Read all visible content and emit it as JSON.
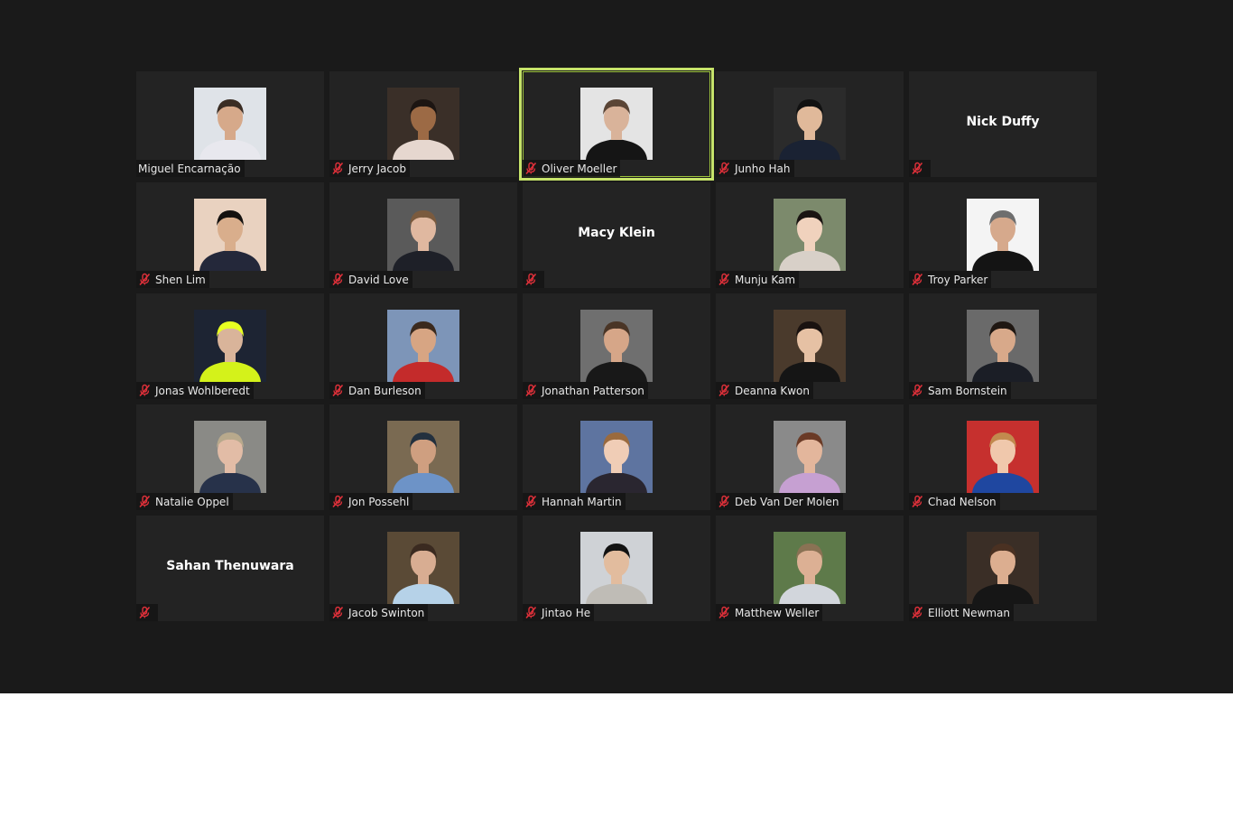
{
  "meeting": {
    "accent": "#c6e36a",
    "muted_color": "#e0303a",
    "participants": [
      {
        "name": "Miguel Encarnação",
        "show_photo": true,
        "muted": false,
        "active": false,
        "skin": "#d6a98a",
        "hair": "#3a2d24",
        "shirt": "#e8e8ee",
        "bg": "#dfe3e8"
      },
      {
        "name": "Jerry Jacob",
        "show_photo": true,
        "muted": true,
        "active": false,
        "skin": "#9c6a45",
        "hair": "#1c1512",
        "shirt": "#e6d7cf",
        "bg": "#3a2f28"
      },
      {
        "name": "Oliver Moeller",
        "show_photo": true,
        "muted": true,
        "active": true,
        "skin": "#d9b39a",
        "hair": "#5a4536",
        "shirt": "#151515",
        "bg": "#e4e4e4"
      },
      {
        "name": "Junho Hah",
        "show_photo": true,
        "muted": true,
        "active": false,
        "skin": "#e0b99a",
        "hair": "#111111",
        "shirt": "#1a2233",
        "bg": "#2b2b2b"
      },
      {
        "name": "Nick Duffy",
        "show_photo": false,
        "muted": true,
        "active": false
      },
      {
        "name": "Shen Lim",
        "show_photo": true,
        "muted": true,
        "active": false,
        "skin": "#d9ae8c",
        "hair": "#14110f",
        "shirt": "#24283a",
        "bg": "#e9d2c0"
      },
      {
        "name": "David Love",
        "show_photo": true,
        "muted": true,
        "active": false,
        "skin": "#e0b8a0",
        "hair": "#7a5a3e",
        "shirt": "#1e2028",
        "bg": "#5a5a5a"
      },
      {
        "name": "Macy Klein",
        "show_photo": false,
        "muted": true,
        "active": false
      },
      {
        "name": "Munju Kam",
        "show_photo": true,
        "muted": true,
        "active": false,
        "skin": "#f0d2bd",
        "hair": "#1a1412",
        "shirt": "#d8d0c8",
        "bg": "#7c8a6c"
      },
      {
        "name": "Troy Parker",
        "show_photo": true,
        "muted": true,
        "active": false,
        "skin": "#d6a98c",
        "hair": "#6e6e6e",
        "shirt": "#141414",
        "bg": "#f4f4f4"
      },
      {
        "name": "Jonas Wohlberedt",
        "show_photo": true,
        "muted": true,
        "active": false,
        "skin": "#d9b49a",
        "hair": "#e8ff22",
        "shirt": "#d4f21a",
        "bg": "#1d2433"
      },
      {
        "name": "Dan Burleson",
        "show_photo": true,
        "muted": true,
        "active": false,
        "skin": "#d7a583",
        "hair": "#3b2a1e",
        "shirt": "#c42b2b",
        "bg": "#7d95b8"
      },
      {
        "name": "Jonathan Patterson",
        "show_photo": true,
        "muted": true,
        "active": false,
        "skin": "#d6a688",
        "hair": "#4a3526",
        "shirt": "#181818",
        "bg": "#6f6f6f"
      },
      {
        "name": "Deanna Kwon",
        "show_photo": true,
        "muted": true,
        "active": false,
        "skin": "#e6c1a4",
        "hair": "#1a1210",
        "shirt": "#151515",
        "bg": "#4a3a2c"
      },
      {
        "name": "Sam Bornstein",
        "show_photo": true,
        "muted": true,
        "active": false,
        "skin": "#d8a98a",
        "hair": "#1f1712",
        "shirt": "#1b1e26",
        "bg": "#6a6a6a"
      },
      {
        "name": "Natalie Oppel",
        "show_photo": true,
        "muted": true,
        "active": false,
        "skin": "#e2bca6",
        "hair": "#b8a98c",
        "shirt": "#27324a",
        "bg": "#8a8a86"
      },
      {
        "name": "Jon Possehl",
        "show_photo": true,
        "muted": true,
        "active": false,
        "skin": "#cf9f80",
        "hair": "#23303e",
        "shirt": "#6d93c7",
        "bg": "#7a6a52"
      },
      {
        "name": "Hannah Martin",
        "show_photo": true,
        "muted": true,
        "active": false,
        "skin": "#f0cdb6",
        "hair": "#9a6a3e",
        "shirt": "#2a2630",
        "bg": "#5e74a0"
      },
      {
        "name": "Deb Van Der Molen",
        "show_photo": true,
        "muted": true,
        "active": false,
        "skin": "#e3b69c",
        "hair": "#6a3a26",
        "shirt": "#c6a0d2",
        "bg": "#8a8a8a"
      },
      {
        "name": "Chad Nelson",
        "show_photo": true,
        "muted": true,
        "active": false,
        "skin": "#f0c8ac",
        "hair": "#c28a4e",
        "shirt": "#1f47a0",
        "bg": "#c6302e"
      },
      {
        "name": "Sahan Thenuwara",
        "show_photo": false,
        "muted": true,
        "active": false
      },
      {
        "name": "Jacob Swinton",
        "show_photo": true,
        "muted": true,
        "active": false,
        "skin": "#d8ad92",
        "hair": "#3a2a20",
        "shirt": "#b6d2e8",
        "bg": "#5a4a36"
      },
      {
        "name": "Jintao He",
        "show_photo": true,
        "muted": true,
        "active": false,
        "skin": "#e2bc9e",
        "hair": "#121212",
        "shirt": "#bfbcb6",
        "bg": "#cfd2d6"
      },
      {
        "name": "Matthew Weller",
        "show_photo": true,
        "muted": true,
        "active": false,
        "skin": "#dcb094",
        "hair": "#8a7254",
        "shirt": "#d2d6dc",
        "bg": "#5e7a4a"
      },
      {
        "name": "Elliott Newman",
        "show_photo": true,
        "muted": true,
        "active": false,
        "skin": "#dcae90",
        "hair": "#4a3122",
        "shirt": "#161616",
        "bg": "#3a2e26"
      }
    ]
  }
}
